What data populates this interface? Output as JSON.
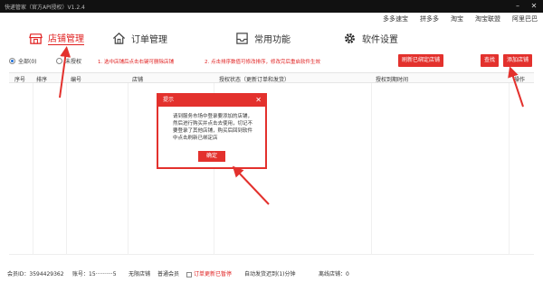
{
  "window": {
    "title": "快递管家（官方API授权）V1.2.4",
    "minimize": "–",
    "close": "✕"
  },
  "links": [
    "多多速宝",
    "拼多多",
    "淘宝",
    "淘宝联盟",
    "阿里巴巴"
  ],
  "nav": [
    {
      "label": "店铺管理",
      "icon": "store-icon",
      "active": true
    },
    {
      "label": "订单管理",
      "icon": "home-icon",
      "active": false
    },
    {
      "label": "常用功能",
      "icon": "inbox-icon",
      "active": false
    },
    {
      "label": "软件设置",
      "icon": "gear-icon",
      "active": false
    }
  ],
  "toolbar": {
    "radio_all": "全部(0)",
    "radio_unauth": "未授权",
    "hint1": "1. 选中店铺后点击右键可删除店铺",
    "hint2": "2. 点击排序数值可修改排序，修改完后重启软件生效",
    "refresh_button": "刷新已绑定店铺",
    "search_button": "查找",
    "add_shop_button": "添加店铺"
  },
  "table": {
    "columns": [
      "序号",
      "排序",
      "编号",
      "店铺",
      "授权状态（更新订单和发货）",
      "授权到期时间",
      "操作"
    ]
  },
  "dialog": {
    "title": "提示",
    "close": "✕",
    "message": "请到服务市场中登录要添加的店铺，然后进行购买并点击去使用，切记不要登录了其他店铺，购买后回到软件中点击刷新已绑定店",
    "ok_button": "确定"
  },
  "status": {
    "member": "会员ID：3594429362",
    "account": "账号：15··········5",
    "limit": "无限店铺",
    "level": "普通会员",
    "order_notice": "订单更新已暂停",
    "auto_send": "自动发货迟到(1)分钟",
    "total": "离线店铺：0"
  },
  "colors": {
    "accent": "#e3312d"
  }
}
